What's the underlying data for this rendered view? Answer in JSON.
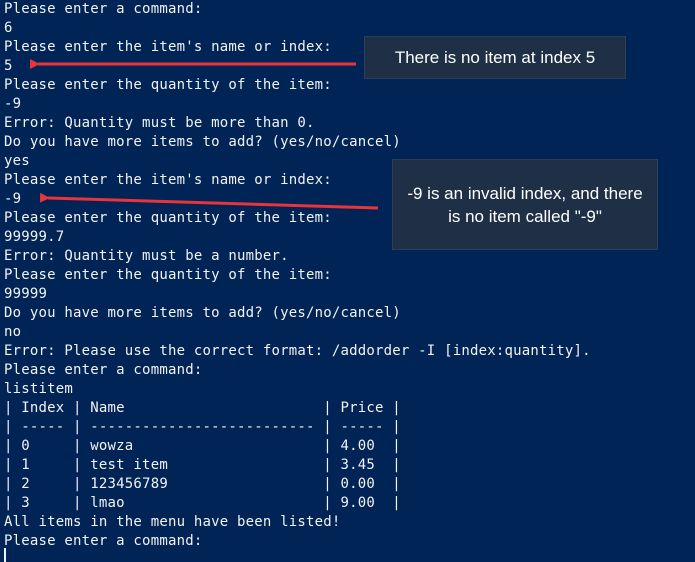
{
  "terminal": {
    "lines": [
      "Please enter a command:",
      "6",
      "Please enter the item's name or index:",
      "5",
      "Please enter the quantity of the item:",
      "-9",
      "Error: Quantity must be more than 0.",
      "Do you have more items to add? (yes/no/cancel)",
      "yes",
      "Please enter the item's name or index:",
      "-9",
      "Please enter the quantity of the item:",
      "99999.7",
      "Error: Quantity must be a number.",
      "Please enter the quantity of the item:",
      "99999",
      "Do you have more items to add? (yes/no/cancel)",
      "no",
      "Error: Please use the correct format: /addorder -I [index:quantity].",
      "Please enter a command:",
      "listitem",
      "| Index | Name                       | Price |",
      "| ----- | -------------------------- | ----- |",
      "| 0     | wowza                      | 4.00  |",
      "| 1     | test item                  | 3.45  |",
      "| 2     | 123456789                  | 0.00  |",
      "| 3     | lmao                       | 9.00  |",
      "All items in the menu have been listed!",
      "Please enter a command:"
    ]
  },
  "annotations": {
    "callout_1": "There is no item at index 5",
    "callout_2": "-9 is an invalid index, and there is no item called \"-9\""
  },
  "colors": {
    "background": "#012456",
    "text": "#f2f2f2",
    "arrow": "#e8343a",
    "callout_bg": "#1f3046"
  }
}
